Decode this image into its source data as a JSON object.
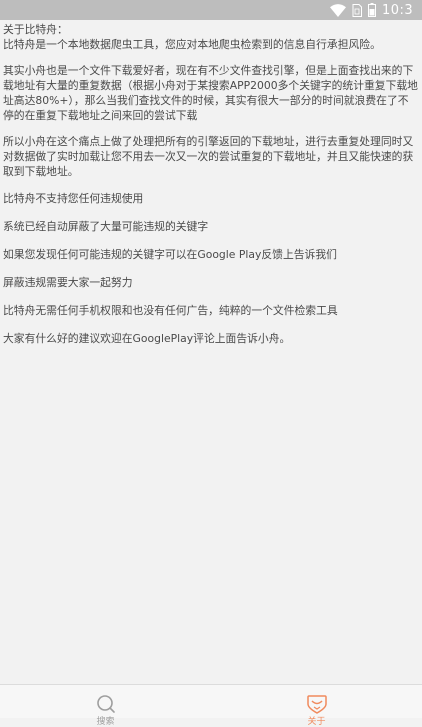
{
  "status_bar": {
    "time": "10:3",
    "icons": [
      "wifi-icon",
      "sim-icon",
      "battery-icon"
    ]
  },
  "about": {
    "heading": "关于比特舟：",
    "para1": "比特舟是一个本地数据爬虫工具，您应对本地爬虫检索到的信息自行承担风险。",
    "para2": "其实小舟也是一个文件下载爱好者，现在有不少文件查找引擎，但是上面查找出来的下载地址有大量的重复数据（根据小舟对于某搜索APP2000多个关键字的统计重复下载地址高达80%+），那么当我们查找文件的时候，其实有很大一部分的时间就浪费在了不停的在重复下载地址之间来回的尝试下载",
    "para3": "所以小舟在这个痛点上做了处理把所有的引擎返回的下载地址，进行去重复处理同时又对数据做了实时加载让您不用去一次又一次的尝试重复的下载地址，并且又能快速的获取到下载地址。",
    "line_no_illegal": "比特舟不支持您任何违规使用",
    "line_blocked": "系统已经自动屏蔽了大量可能违规的关键字",
    "line_report": "如果您发现任何可能违规的关键字可以在Google Play反馈上告诉我们",
    "line_together": "屏蔽违规需要大家一起努力",
    "line_no_perm": "比特舟无需任何手机权限和也没有任何广告，纯粹的一个文件检索工具",
    "line_feedback": "大家有什么好的建议欢迎在GooglePlay评论上面告诉小舟。"
  },
  "bottom_nav": {
    "tabs": [
      {
        "icon": "search-icon",
        "label": "搜索"
      },
      {
        "icon": "about-icon",
        "label": "关于"
      }
    ],
    "active_color": "#f08a5d",
    "inactive_color": "#9e9e9e"
  }
}
